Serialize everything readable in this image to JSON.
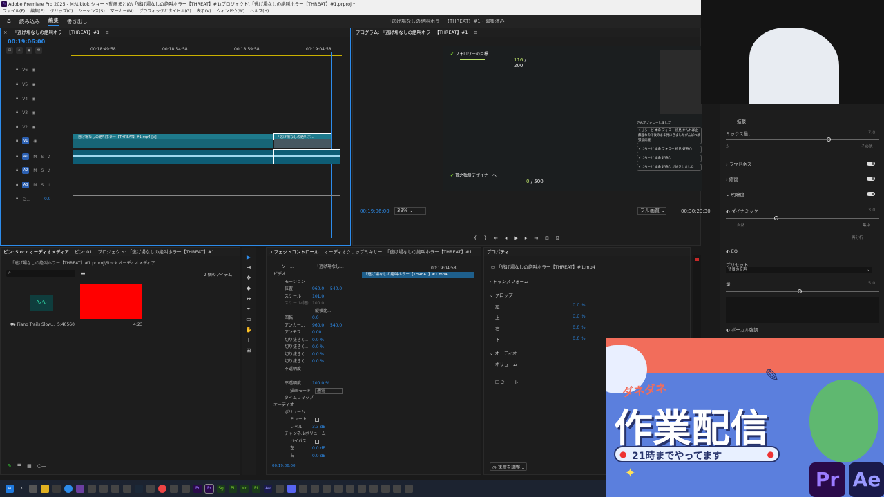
{
  "window": {
    "title": "Adobe Premiere Pro 2025 - M:\\tiktok ショート動画まとめ\\「逃げ場なしの絶叫ホラー【THREAT】#1\\プロジェクト\\「逃げ場なしの絶叫ホラー【THREAT】#1.prproj *",
    "app_icon": "Pr"
  },
  "menu": [
    "ファイル(F)",
    "編集(E)",
    "クリップ(C)",
    "シーケンス(S)",
    "マーカー(M)",
    "グラフィックとタイトル(G)",
    "表示(V)",
    "ウィンドウ(W)",
    "ヘルプ(H)"
  ],
  "workspace": {
    "tabs": [
      "読み込み",
      "編集",
      "書き出し"
    ],
    "active": "編集",
    "center_title": "「逃げ場なしの絶叫ホラー【THREAT】#1 - 編集済み"
  },
  "timeline": {
    "tab": "「逃げ場なしの絶叫ホラー【THREAT】#1",
    "timecode": "00:19:06:00",
    "ruler": [
      "00:18:49:58",
      "00:18:54:58",
      "00:18:59:58",
      "00:19:04:58"
    ],
    "tracks": [
      "V6",
      "V5",
      "V4",
      "V3",
      "V2",
      "V1",
      "A1",
      "A2",
      "A3"
    ],
    "mix_label": "ミ...",
    "mix_value": "0.0",
    "clip1": "「逃げ場なしの絶叫ホラー【THREAT】#1.mp4 [V]",
    "clip2": "「逃げ場なしの絶叫ホ...",
    "fx_badge": "fx",
    "track_btn_m": "M",
    "track_btn_s": "S"
  },
  "program": {
    "tab": "プログラム: 「逃げ場なしの絶叫ホラー【THREAT】#1",
    "timecode": "00:19:06:00",
    "zoom": "39%",
    "quality": "フル画質",
    "duration": "00:30:23:30",
    "hud_top_label": "フォロワーの目標",
    "hud_top_value": "116",
    "hud_top_total": "/ 200",
    "hud_bottom_label": "貫之独身デザイナーへ",
    "hud_bottom_value": "0",
    "hud_bottom_total": "/ 500",
    "chat": [
      "さんがフォローしました",
      "くじらーど 本命 フォロー 初見 かんれば止無理なので後のまま見にきましたがんばれ頑張る応援",
      "くじらーど 本命 フォロー 初見 好奇心",
      "くじらーど 本命 好奇心",
      "くじらーど 本命 好奇心 が好きしました"
    ]
  },
  "bin": {
    "tab1": "ビン: Stock オーディオメディア",
    "tab2": "ビン: 01",
    "tab3": "プロジェクト: 「逃げ場なしの絶叫ホラー【THREAT】#1",
    "path": "「逃げ場なしの絶叫ホラー【THREAT】#1.prproj\\Stock オーディオメディア",
    "count": "2 個のアイテム",
    "item1_name": "Piano Trails Slow...",
    "item1_dur": "5:40560",
    "item2_dur": "4:23"
  },
  "effect_controls": {
    "tab1": "エフェクトコントロール",
    "tab2": "オーディオクリップミキサー: 「逃げ場なしの絶叫ホラー【THREAT】#1",
    "source": "ソー...",
    "seq": "「逃げ場なし...",
    "time": "00:19:04:58",
    "clip": "「逃げ場なしの絶叫ホラー【THREAT】#1.mp4",
    "video": "ビデオ",
    "motion": "モーション",
    "position": "位置",
    "pos_x": "960.0",
    "pos_y": "540.0",
    "scale": "スケール",
    "scale_v": "101.0",
    "scale_w": "スケール(幅)",
    "scale_w_v": "100.0",
    "uniform": "縦横比...",
    "rotation": "回転",
    "rotation_v": "0.0",
    "anchor": "アンカー...",
    "anchor_x": "960.0",
    "anchor_y": "540.0",
    "antiflicker": "アンチフ...",
    "antiflicker_v": "0.00",
    "crop1": "切り抜き (...",
    "crop1_v": "0.0 %",
    "crop2": "切り抜き (...",
    "crop2_v": "0.0 %",
    "crop3": "切り抜き (...",
    "crop3_v": "0.0 %",
    "crop4": "切り抜き (...",
    "crop4_v": "0.0 %",
    "opacity": "不透明度",
    "opacity_label": "不透明度",
    "opacity_v": "100.0 %",
    "blend": "描画モード",
    "blend_v": "通常",
    "timeremap": "タイムリマップ",
    "audio": "オーディオ",
    "volume": "ボリューム",
    "mute": "ミュート",
    "level": "レベル",
    "level_v": "3.3 dB",
    "chvol": "チャンネルボリューム",
    "bypass": "バイパス",
    "left": "左",
    "left_v": "0.0 dB",
    "right": "右",
    "right_v": "0.0 dB",
    "footer_time": "00:19:06:00"
  },
  "properties": {
    "tab": "プロパティ",
    "clip": "「逃げ場なしの絶叫ホラー【THREAT】#1.mp4",
    "transform": "トランスフォーム",
    "crop": "クロップ",
    "left": "左",
    "left_v": "0.0 %",
    "top": "上",
    "top_v": "0.0 %",
    "right": "右",
    "right_v": "0.0 %",
    "bottom": "下",
    "bottom_v": "0.0 %",
    "audio": "オーディオ",
    "volume": "ボリューム",
    "mute": "ミュート",
    "adjust": "速度を調整..."
  },
  "essential_sound": {
    "ext": "拡張",
    "mix": "ミックス量：",
    "mix_v": "7.0",
    "lo": "少",
    "hi": "その他",
    "loudness": "ラウドネス",
    "repair": "修復",
    "clarity": "明瞭度",
    "dynamics": "ダイナミック",
    "dyn_v": "3.0",
    "natural": "自然",
    "focused": "集中",
    "reanalyze": "再分析",
    "eq": "EQ",
    "preset": "プリセット",
    "preset_v": "背景の音声",
    "amount": "量",
    "amount_v": "5.0",
    "vocal": "ボーカル強調"
  },
  "overlay": {
    "kicker": "ダネダネ",
    "title": "作業配信",
    "subtitle": "21時までやってます",
    "apps": [
      "Pr",
      "Ae"
    ]
  },
  "taskbar_icons": [
    "Pr",
    "Sg",
    "Pt",
    "Md",
    "Pt",
    "Ae"
  ],
  "colors": {
    "accent": "#2d8ceb",
    "clip_video": "#1e7a8c",
    "clip_audio": "#0e5d75",
    "banner": "#5b7fdd",
    "pr_purple": "#2a0a4a"
  }
}
